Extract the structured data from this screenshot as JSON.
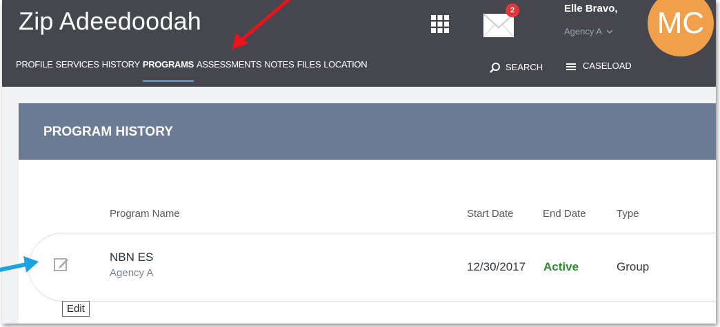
{
  "client": {
    "name": "Zip Adeedoodah"
  },
  "nav": {
    "items": [
      {
        "label": "PROFILE",
        "active": false
      },
      {
        "label": "SERVICES",
        "active": false
      },
      {
        "label": "HISTORY",
        "active": false
      },
      {
        "label": "PROGRAMS",
        "active": true
      },
      {
        "label": "ASSESSMENTS",
        "active": false
      },
      {
        "label": "NOTES",
        "active": false
      },
      {
        "label": "FILES",
        "active": false
      },
      {
        "label": "LOCATION",
        "active": false
      }
    ],
    "search_label": "SEARCH",
    "caseload_label": "CASELOAD"
  },
  "notifications": {
    "count": "2"
  },
  "user": {
    "name": "Elle Bravo,",
    "agency": "Agency A",
    "initials": "MC"
  },
  "program_history": {
    "title": "PROGRAM HISTORY",
    "columns": {
      "name": "Program Name",
      "start": "Start Date",
      "end": "End Date",
      "type": "Type"
    },
    "rows": [
      {
        "name": "NBN ES",
        "agency": "Agency A",
        "start_date": "12/30/2017",
        "end_date": "Active",
        "type": "Group"
      }
    ],
    "edit_tooltip": "Edit"
  },
  "colors": {
    "header_bg": "#45464e",
    "card_header_bg": "#6b7b93",
    "avatar_bg": "#f0a04b",
    "badge_bg": "#e0383a",
    "active_status": "#2d8a2d",
    "red_arrow": "#e8141c",
    "blue_arrow": "#1aa3e0"
  }
}
